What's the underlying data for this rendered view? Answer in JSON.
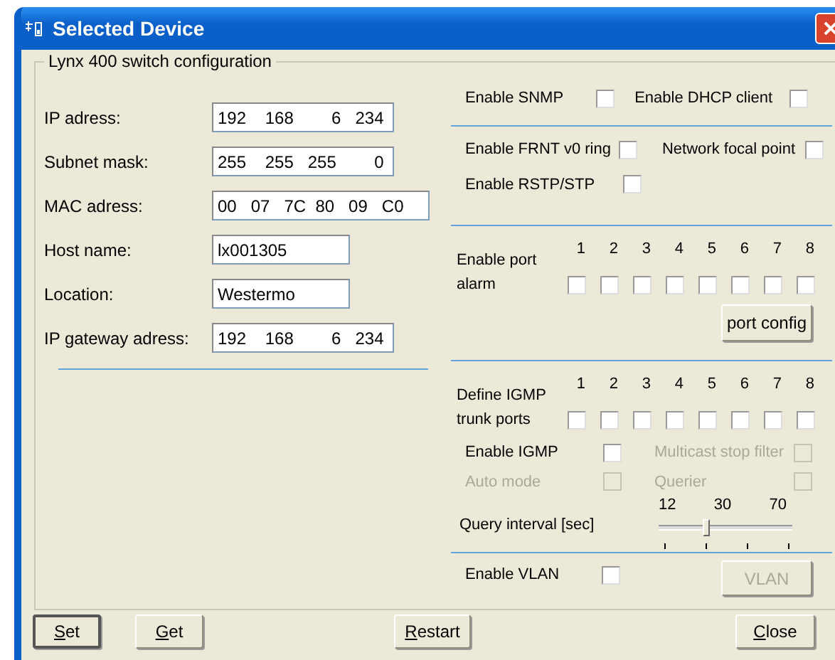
{
  "window": {
    "title": "Selected Device"
  },
  "group": {
    "title": "Lynx 400 switch configuration"
  },
  "fields": [
    {
      "label": "IP adress:",
      "value": "192    168        6   234",
      "kind": "ip"
    },
    {
      "label": "Subnet mask:",
      "value": "255    255   255        0",
      "kind": "ip"
    },
    {
      "label": "MAC adress:",
      "value": "00   07   7C  80   09   C0",
      "kind": "mac"
    },
    {
      "label": "Host name:",
      "value": "lx001305",
      "kind": "text"
    },
    {
      "label": "Location:",
      "value": "Westermo",
      "kind": "text"
    },
    {
      "label": "IP gateway adress:",
      "value": "192    168        6   234",
      "kind": "ip"
    }
  ],
  "options_top": [
    {
      "label": "Enable SNMP",
      "checked": false
    },
    {
      "label": "Enable DHCP client",
      "checked": false
    }
  ],
  "ring": [
    {
      "label": "Enable FRNT v0 ring",
      "checked": false
    },
    {
      "label": "Network focal point",
      "checked": false
    },
    {
      "label": "Enable RSTP/STP",
      "checked": false
    }
  ],
  "port_alarm": {
    "label": "Enable port alarm",
    "button": "port config",
    "ports": [
      {
        "label": "1",
        "checked": false
      },
      {
        "label": "2",
        "checked": false
      },
      {
        "label": "3",
        "checked": false
      },
      {
        "label": "4",
        "checked": false
      },
      {
        "label": "5",
        "checked": false
      },
      {
        "label": "6",
        "checked": false
      },
      {
        "label": "7",
        "checked": false
      },
      {
        "label": "8",
        "checked": false
      }
    ]
  },
  "igmp_trunk": {
    "label": "Define IGMP trunk ports",
    "ports": [
      {
        "label": "1",
        "checked": false
      },
      {
        "label": "2",
        "checked": false
      },
      {
        "label": "3",
        "checked": false
      },
      {
        "label": "4",
        "checked": false
      },
      {
        "label": "5",
        "checked": false
      },
      {
        "label": "6",
        "checked": false
      },
      {
        "label": "7",
        "checked": false
      },
      {
        "label": "8",
        "checked": false
      }
    ]
  },
  "igmp": [
    {
      "label": "Enable IGMP",
      "checked": false,
      "disabled": false
    },
    {
      "label": "Multicast stop filter",
      "checked": false,
      "disabled": true
    },
    {
      "label": "Auto mode",
      "checked": false,
      "disabled": true
    },
    {
      "label": "Querier",
      "checked": false,
      "disabled": true
    }
  ],
  "query": {
    "label": "Query interval [sec]",
    "ticks": [
      "12",
      "30",
      "70"
    ],
    "level": 0.35
  },
  "vlan": {
    "label": "Enable VLAN",
    "checked": false,
    "button": {
      "label": "VLAN",
      "disabled": true
    }
  },
  "buttons": [
    {
      "label": "Set",
      "mnemonic": true,
      "default": true
    },
    {
      "label": "Get",
      "mnemonic": true,
      "default": false
    },
    {
      "label": "Restart",
      "mnemonic": true,
      "default": false
    },
    {
      "label": "Close",
      "mnemonic": true,
      "default": false
    }
  ]
}
